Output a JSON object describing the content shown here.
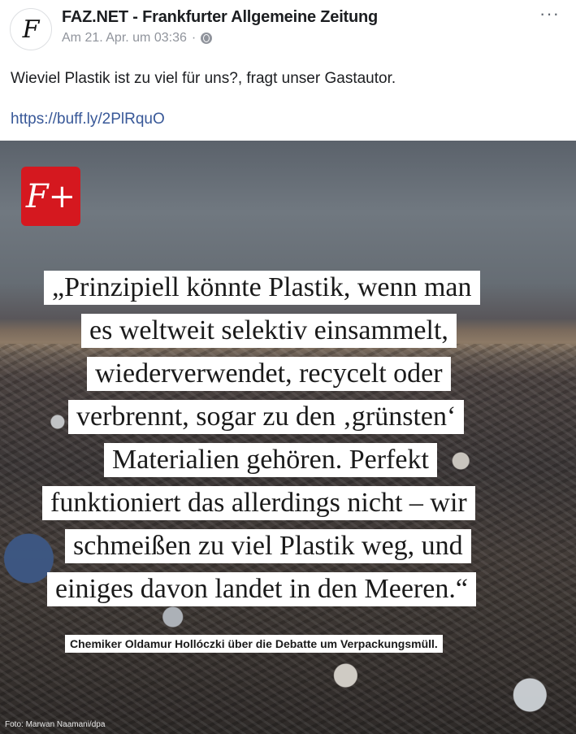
{
  "post": {
    "page_name": "FAZ.NET - Frankfurter Allgemeine Zeitung",
    "timestamp": "Am 21. Apr. um 03:36",
    "separator": "·",
    "privacy_icon": "globe-icon",
    "avatar_glyph": "F",
    "more_icon": "more-dots-icon",
    "more_label": "···",
    "text": "Wieviel Plastik ist zu viel für uns?, fragt unser Gastautor.",
    "link": "https://buff.ly/2PlRquO"
  },
  "image": {
    "badge": "F+",
    "badge_color": "#d5181f",
    "quote_lines": [
      "„Prinzipiell könnte Plastik, wenn man",
      "es weltweit selektiv einsammelt,",
      "wiederverwendet, recycelt oder",
      "verbrennt, sogar zu den ‚grünsten‘",
      "Materialien gehören. Perfekt",
      "funktioniert das allerdings nicht – wir",
      "schmeißen zu viel Plastik weg, und",
      "einiges davon landet in den Meeren.“"
    ],
    "credit": "Chemiker Oldamur Hollóczki über die Debatte um Verpackungsmüll.",
    "photo_credit": "Foto: Marwan Naamani/dpa"
  },
  "colors": {
    "link": "#385898",
    "meta": "#90949c",
    "text": "#1c1e21"
  }
}
